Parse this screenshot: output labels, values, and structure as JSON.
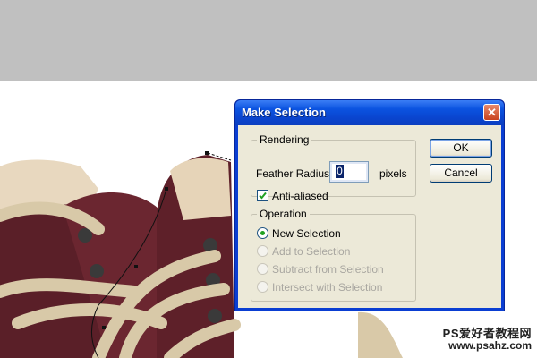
{
  "dialog": {
    "title": "Make Selection",
    "close_symbol": "✕",
    "rendering": {
      "group_label": "Rendering",
      "feather_label": "Feather Radius:",
      "feather_value": "0",
      "feather_unit": "pixels",
      "anti_aliased_label": "Anti-aliased",
      "anti_aliased_checked": true
    },
    "operation": {
      "group_label": "Operation",
      "options": [
        {
          "label": "New Selection",
          "selected": true,
          "enabled": true
        },
        {
          "label": "Add to Selection",
          "selected": false,
          "enabled": false
        },
        {
          "label": "Subtract from Selection",
          "selected": false,
          "enabled": false
        },
        {
          "label": "Intersect with Selection",
          "selected": false,
          "enabled": false
        }
      ]
    },
    "buttons": {
      "ok": "OK",
      "cancel": "Cancel"
    }
  },
  "watermark": {
    "site_name": "PS爱好者教程网",
    "url": "www.psahz.com"
  },
  "colors": {
    "titlebar": "#0b53e0",
    "dialog_bg": "#ece9d8",
    "background_band": "#c0c0c0",
    "shoe_leather": "#5a1f28",
    "laces": "#d8c9a8"
  },
  "icons": {
    "close": "close-icon",
    "check": "checkmark-icon",
    "radio": "radio-dot-icon"
  }
}
